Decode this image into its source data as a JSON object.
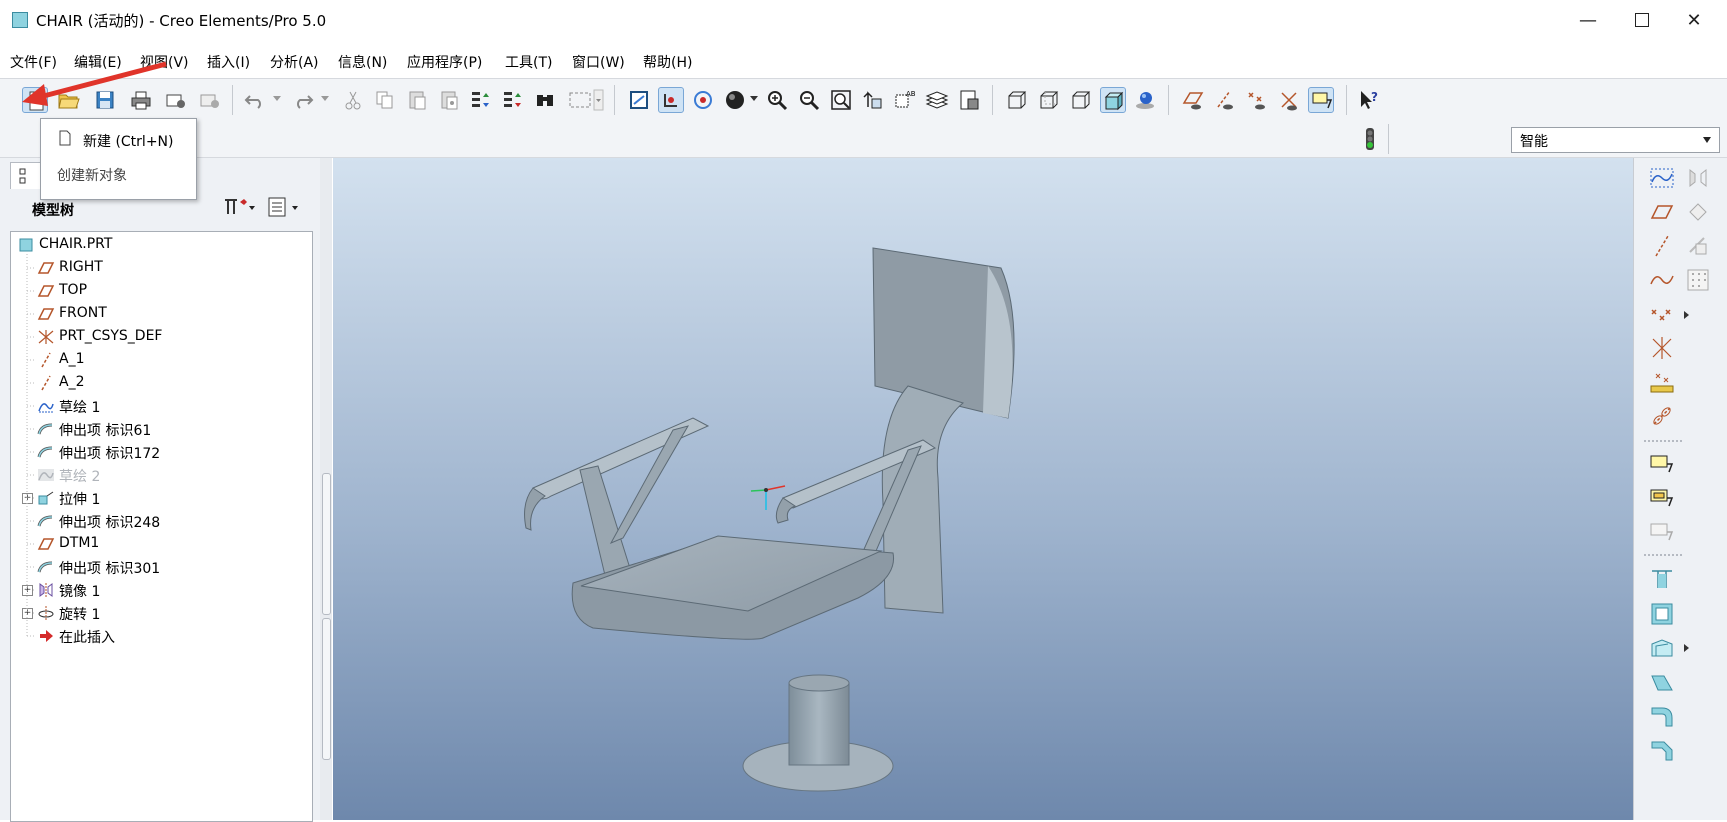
{
  "window": {
    "title": "CHAIR (活动的) - Creo Elements/Pro 5.0",
    "controls": [
      "minimize",
      "maximize",
      "close"
    ]
  },
  "menu": [
    "文件(F)",
    "编辑(E)",
    "视图(V)",
    "插入(I)",
    "分析(A)",
    "信息(N)",
    "应用程序(P)",
    "工具(T)",
    "窗口(W)",
    "帮助(H)"
  ],
  "tooltip": {
    "command": "新建 (Ctrl+N)",
    "description": "创建新对象"
  },
  "filter": {
    "selected": "智能"
  },
  "model_tree": {
    "header": "模型树",
    "items": [
      {
        "label": "CHAIR.PRT",
        "icon": "part-icon"
      },
      {
        "label": "RIGHT",
        "icon": "datum-plane-icon"
      },
      {
        "label": "TOP",
        "icon": "datum-plane-icon"
      },
      {
        "label": "FRONT",
        "icon": "datum-plane-icon"
      },
      {
        "label": "PRT_CSYS_DEF",
        "icon": "csys-icon"
      },
      {
        "label": "A_1",
        "icon": "datum-axis-icon"
      },
      {
        "label": "A_2",
        "icon": "datum-axis-icon"
      },
      {
        "label": "草绘 1",
        "icon": "sketch-icon"
      },
      {
        "label": "伸出项 标识61",
        "icon": "sweep-icon"
      },
      {
        "label": "伸出项 标识172",
        "icon": "sweep-icon"
      },
      {
        "label": "草绘 2",
        "icon": "sketch-icon",
        "suppressed": true
      },
      {
        "label": "拉伸 1",
        "icon": "extrude-icon",
        "expandable": true
      },
      {
        "label": "伸出项 标识248",
        "icon": "sweep-icon"
      },
      {
        "label": "DTM1",
        "icon": "datum-plane-icon"
      },
      {
        "label": "伸出项 标识301",
        "icon": "sweep-icon"
      },
      {
        "label": "镜像 1",
        "icon": "mirror-icon",
        "expandable": true
      },
      {
        "label": "旋转 1",
        "icon": "revolve-icon",
        "expandable": true
      },
      {
        "label": "在此插入",
        "icon": "insert-here-icon"
      }
    ]
  },
  "colors": {
    "accent": "#3a7bd5",
    "datum": "#b5562b",
    "viewport_top": "#d3e1ef",
    "viewport_bottom": "#6e88ac",
    "annotation_arrow": "#e0342a"
  }
}
